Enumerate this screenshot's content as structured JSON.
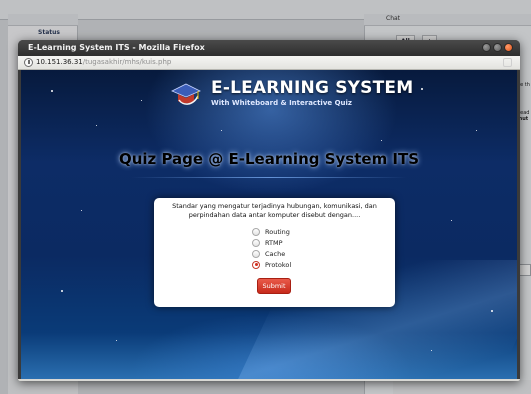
{
  "background_app": {
    "left_panel_header": "Status",
    "chat_title": "Chat",
    "chat_tabs": [
      "All",
      "+"
    ],
    "right_snippets": [
      "ee th",
      "head",
      "mut"
    ]
  },
  "browser": {
    "window_title": "E-Learning System ITS - Mozilla Firefox",
    "url_host": "10.151.36.31",
    "url_path": "/tugasakhir/mhs/kuis.php",
    "window_buttons": [
      "minimize-icon",
      "maximize-icon",
      "close-icon"
    ]
  },
  "site": {
    "logo_title": "E-LEARNING SYSTEM",
    "logo_subtitle": "With Whiteboard & Interactive Quiz",
    "page_heading": "Quiz Page @ E-Learning System ITS"
  },
  "quiz": {
    "question": "Standar yang mengatur terjadinya hubungan, komunikasi, dan perpindahan data antar komputer disebut dengan....",
    "options": [
      {
        "label": "Routing",
        "checked": false
      },
      {
        "label": "RTMP",
        "checked": false
      },
      {
        "label": "Cache",
        "checked": false
      },
      {
        "label": "Protokol",
        "checked": true
      }
    ],
    "submit_label": "Submit"
  },
  "colors": {
    "titlebar": "#2e2e2e",
    "page_background": "#0d2c66",
    "submit_button": "#d63a2a",
    "card": "#ffffff"
  }
}
